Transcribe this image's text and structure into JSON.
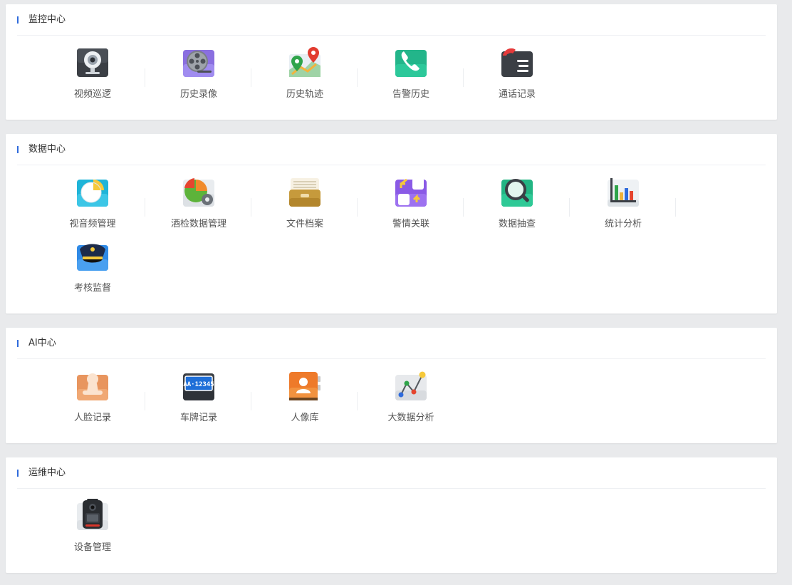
{
  "sections": [
    {
      "title": "监控中心",
      "items": [
        {
          "label": "视频巡逻",
          "icon": "camera-icon"
        },
        {
          "label": "历史录像",
          "icon": "film-reel-icon"
        },
        {
          "label": "历史轨迹",
          "icon": "map-pin-icon"
        },
        {
          "label": "告警历史",
          "icon": "phone-icon"
        },
        {
          "label": "通话记录",
          "icon": "call-log-icon"
        }
      ]
    },
    {
      "title": "数据中心",
      "items": [
        {
          "label": "视音频管理",
          "icon": "pie-chart-icon"
        },
        {
          "label": "酒检数据管理",
          "icon": "pie-gear-icon"
        },
        {
          "label": "文件档案",
          "icon": "file-box-icon"
        },
        {
          "label": "警情关联",
          "icon": "link-blocks-icon"
        },
        {
          "label": "数据抽查",
          "icon": "magnifier-icon"
        },
        {
          "label": "统计分析",
          "icon": "bar-chart-icon"
        },
        {
          "label": "考核监督",
          "icon": "police-cap-icon"
        }
      ]
    },
    {
      "title": "AI中心",
      "items": [
        {
          "label": "人脸记录",
          "icon": "face-stamp-icon"
        },
        {
          "label": "车牌记录",
          "icon": "license-plate-icon"
        },
        {
          "label": "人像库",
          "icon": "contact-book-icon"
        },
        {
          "label": "大数据分析",
          "icon": "analysis-graph-icon"
        }
      ]
    },
    {
      "title": "运维中心",
      "items": [
        {
          "label": "设备管理",
          "icon": "body-camera-icon"
        }
      ]
    }
  ],
  "plate_text": "AA·12345"
}
